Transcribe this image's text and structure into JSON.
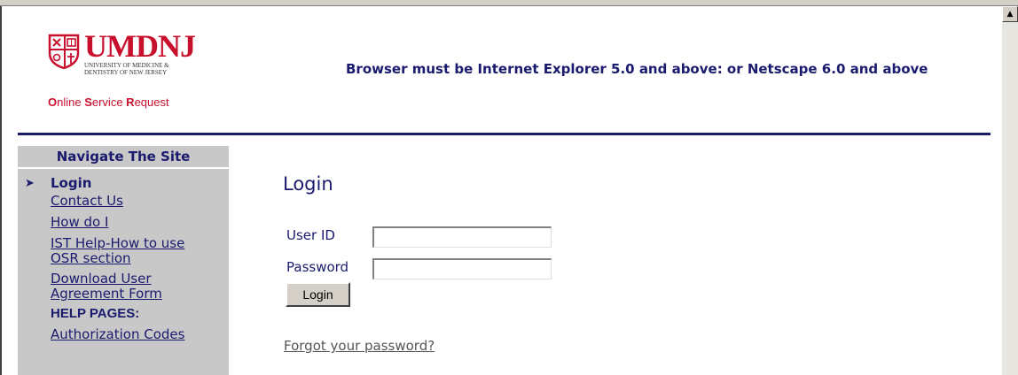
{
  "logo": {
    "title": "UMDNJ",
    "subtitle_line1": "University of Medicine &",
    "subtitle_line2": "Dentistry of New Jersey",
    "tagline_o": "O",
    "tagline_1": "nline ",
    "tagline_s": "S",
    "tagline_2": "ervice ",
    "tagline_r": "R",
    "tagline_3": "equest",
    "brand_color": "#c8102e"
  },
  "browser_note": "Browser must be Internet Explorer 5.0 and above: or Netscape 6.0 and above",
  "sidebar": {
    "header": "Navigate The Site",
    "current_marker": "➤",
    "items": [
      {
        "label": "Login",
        "current": true
      },
      {
        "label": "Contact Us"
      },
      {
        "label": "How do I"
      },
      {
        "label": "IST Help-How to use OSR section"
      },
      {
        "label": "Download User Agreement Form"
      },
      {
        "label": "HELP PAGES:",
        "heading": true
      },
      {
        "label": "Authorization Codes"
      }
    ]
  },
  "login": {
    "title": "Login",
    "user_id_label": "User ID",
    "user_id_value": "",
    "password_label": "Password",
    "password_value": "",
    "button_label": "Login",
    "forgot_link": "Forgot your password?"
  },
  "colors": {
    "accent": "#1a1a6e",
    "sidebar_bg": "#c8c8c8",
    "chrome": "#d4d0c8"
  },
  "scrollbar": {
    "up_arrow": "▲"
  }
}
